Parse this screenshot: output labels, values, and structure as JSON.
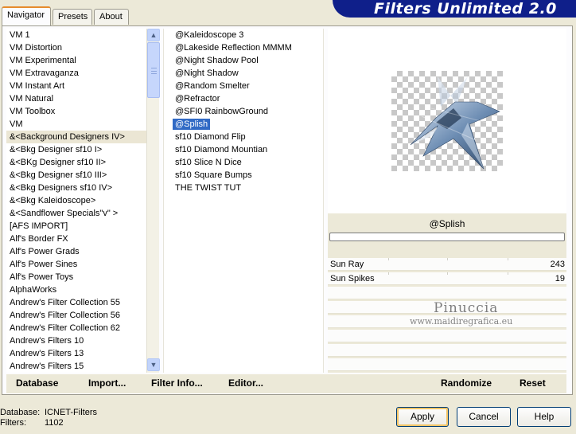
{
  "tabs": [
    {
      "label": "Navigator",
      "active": true
    },
    {
      "label": "Presets",
      "active": false
    },
    {
      "label": "About",
      "active": false
    }
  ],
  "banner": {
    "title": "Filters Unlimited 2.0",
    "color": "#0f1f8a"
  },
  "categories": [
    "VM 1",
    "VM Distortion",
    "VM Experimental",
    "VM Extravaganza",
    "VM Instant Art",
    "VM Natural",
    "VM Toolbox",
    "VM",
    "&<Background Designers IV>",
    "&<Bkg Designer sf10 I>",
    "&<BKg Designer sf10 II>",
    "&<Bkg Designer sf10 III>",
    "&<Bkg Designers sf10 IV>",
    "&<Bkg Kaleidoscope>",
    "&<Sandflower Specials\"v\" >",
    "[AFS IMPORT]",
    "Alf's Border FX",
    "Alf's Power Grads",
    "Alf's Power Sines",
    "Alf's Power Toys",
    "AlphaWorks",
    "Andrew's Filter Collection 55",
    "Andrew's Filter Collection 56",
    "Andrew's Filter Collection 62",
    "Andrew's Filters 10",
    "Andrew's Filters 13",
    "Andrew's Filters 15"
  ],
  "selected_category": "&<Background Designers IV>",
  "filters": [
    "@Kaleidoscope 3",
    "@Lakeside Reflection MMMM",
    "@Night Shadow Pool",
    "@Night Shadow",
    "@Random Smelter",
    "@Refractor",
    "@SFI0 RainbowGround",
    "@Splish",
    "sf10 Diamond Flip",
    "sf10 Diamond Mountian",
    "sf10 Slice N Dice",
    "sf10 Square Bumps",
    "THE TWIST TUT"
  ],
  "selected_filter": "@Splish",
  "preview": {
    "filter_name": "@Splish",
    "progress": 0
  },
  "params": [
    {
      "label": "Sun Ray",
      "value": "243"
    },
    {
      "label": "Sun Spikes",
      "value": "19"
    }
  ],
  "watermark": {
    "name": "Pinuccia",
    "url": "www.maidiregrafica.eu"
  },
  "actions": {
    "database": "Database",
    "import": "Import...",
    "filter_info": "Filter Info...",
    "editor": "Editor...",
    "randomize": "Randomize",
    "reset": "Reset"
  },
  "footer": {
    "database_label": "Database:",
    "database_value": "ICNET-Filters",
    "filters_label": "Filters:",
    "filters_value": "1102"
  },
  "buttons": {
    "apply": "Apply",
    "cancel": "Cancel",
    "help": "Help"
  },
  "colors": {
    "selection": "#316ac5",
    "window_bg": "#ece9d8",
    "focus_border": "#f4c567"
  }
}
